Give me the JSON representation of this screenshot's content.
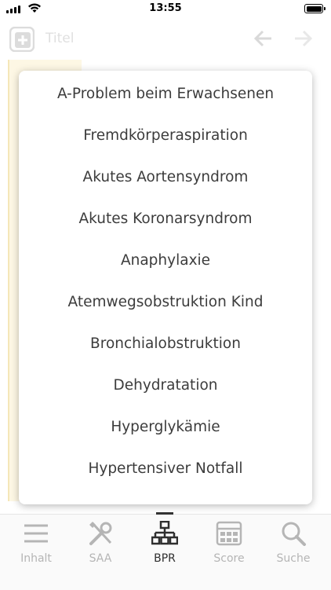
{
  "status_bar": {
    "time": "13:55"
  },
  "header": {
    "title": "Titel"
  },
  "popup": {
    "items": [
      "A-Problem beim Erwachsenen",
      "Fremdkörperaspiration",
      "Akutes Aortensyndrom",
      "Akutes Koronarsyndrom",
      "Anaphylaxie",
      "Atemwegsobstruktion Kind",
      "Bronchialobstruktion",
      "Dehydratation",
      "Hyperglykämie",
      "Hypertensiver Notfall"
    ]
  },
  "tabs": [
    {
      "label": "Inhalt",
      "icon": "menu-icon",
      "active": false
    },
    {
      "label": "SAA",
      "icon": "tools-icon",
      "active": false
    },
    {
      "label": "BPR",
      "icon": "sitemap-icon",
      "active": true
    },
    {
      "label": "Score",
      "icon": "grid-icon",
      "active": false
    },
    {
      "label": "Suche",
      "icon": "search-icon",
      "active": false
    }
  ],
  "colors": {
    "accent": "#2f2f2f",
    "inactive": "#b5b5b5",
    "popup_text": "#3c3c3c"
  }
}
